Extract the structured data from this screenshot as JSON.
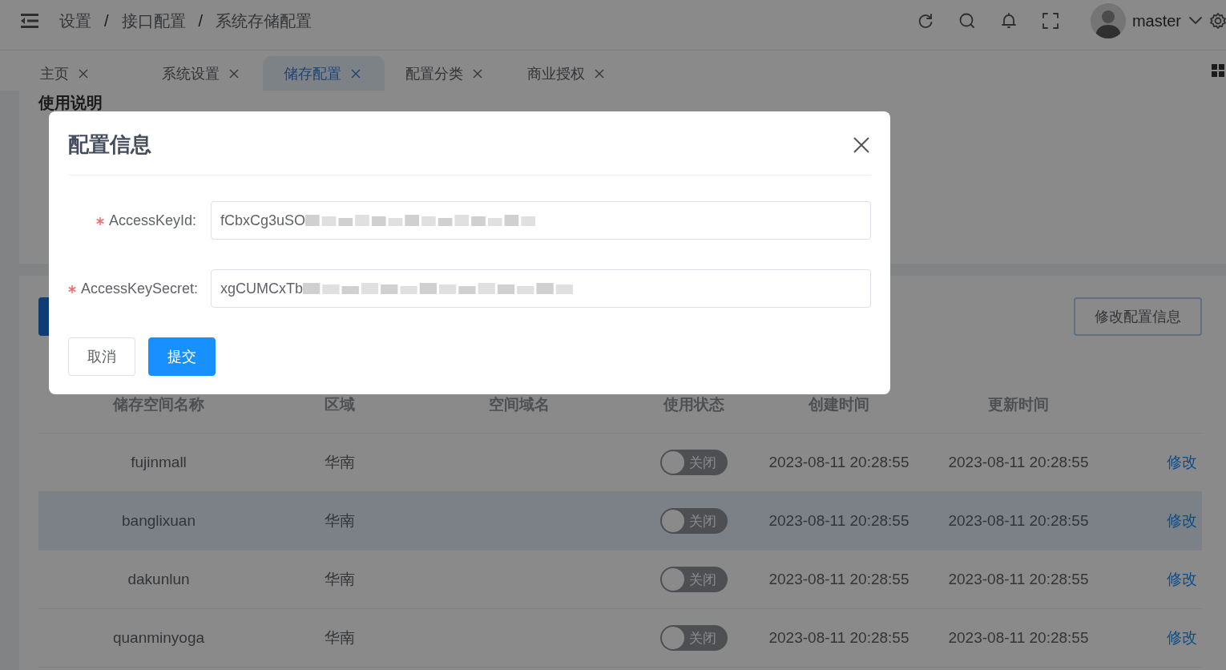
{
  "header": {
    "breadcrumb": [
      "设置",
      "接口配置",
      "系统存储配置"
    ],
    "separator": "/",
    "user": "master"
  },
  "tabs": [
    {
      "label": "主页",
      "selected": false
    },
    {
      "label": "系统设置",
      "selected": false
    },
    {
      "label": "储存配置",
      "selected": true
    },
    {
      "label": "配置分类",
      "selected": false
    },
    {
      "label": "商业授权",
      "selected": false
    }
  ],
  "usage": {
    "title": "使用说明"
  },
  "toolbar": {
    "edit_button": "修改配置信息"
  },
  "table": {
    "columns": [
      "储存空间名称",
      "区域",
      "空间域名",
      "使用状态",
      "创建时间",
      "更新时间"
    ],
    "rows": [
      {
        "name": "fujinmall",
        "region": "华南",
        "status": {
          "on": false,
          "label": "关闭"
        },
        "created": "2023-08-11 20:28:55",
        "updated": "2023-08-11 20:28:55",
        "action": "修改",
        "highlighted": false
      },
      {
        "name": "banglixuan",
        "region": "华南",
        "status": {
          "on": false,
          "label": "关闭"
        },
        "created": "2023-08-11 20:28:55",
        "updated": "2023-08-11 20:28:55",
        "action": "修改",
        "highlighted": true
      },
      {
        "name": "dakunlun",
        "region": "华南",
        "status": {
          "on": false,
          "label": "关闭"
        },
        "created": "2023-08-11 20:28:55",
        "updated": "2023-08-11 20:28:55",
        "action": "修改",
        "highlighted": false
      },
      {
        "name": "quanminyoga",
        "region": "华南",
        "status": {
          "on": false,
          "label": "关闭"
        },
        "created": "2023-08-11 20:28:55",
        "updated": "2023-08-11 20:28:55",
        "action": "修改",
        "highlighted": false
      }
    ]
  },
  "dialog": {
    "title": "配置信息",
    "fields": [
      {
        "label": "AccessKeyId:",
        "required": true,
        "value": "fCbxCg3uSO"
      },
      {
        "label": "AccessKeySecret:",
        "required": true,
        "value": "xgCUMCxTb"
      }
    ],
    "buttons": [
      {
        "label": "取消",
        "kind": "default"
      },
      {
        "label": "提交",
        "kind": "primary"
      }
    ]
  }
}
